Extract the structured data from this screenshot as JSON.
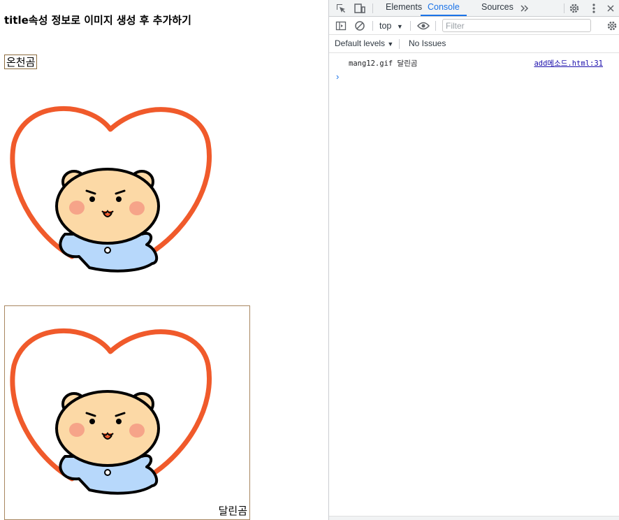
{
  "page": {
    "title": "title속성 정보로 이미지 생성 후 추가하기",
    "name_box": "온천곰",
    "card_caption": "달린곰"
  },
  "devtools": {
    "tabs": [
      "Elements",
      "Console",
      "Sources"
    ],
    "active_tab": "Console",
    "context": "top",
    "filter_placeholder": "Filter",
    "levels": "Default levels",
    "issues": "No Issues",
    "log": {
      "message": "mang12.gif 달린곰",
      "source": "add메소드.html:31"
    },
    "accent_color": "#1a73e8"
  },
  "icons": [
    "inspect-icon",
    "device-toggle-icon",
    "more-tabs-icon",
    "settings-icon",
    "kebab-menu-icon",
    "sidebar-icon",
    "clear-console-icon",
    "eye-icon",
    "console-settings-icon",
    "prompt-chevron-icon"
  ],
  "colors": {
    "heart": "#f05a2b",
    "bear_face": "#fcd9a6",
    "bear_body": "#b7d8fb",
    "cheek": "#f59a84"
  }
}
